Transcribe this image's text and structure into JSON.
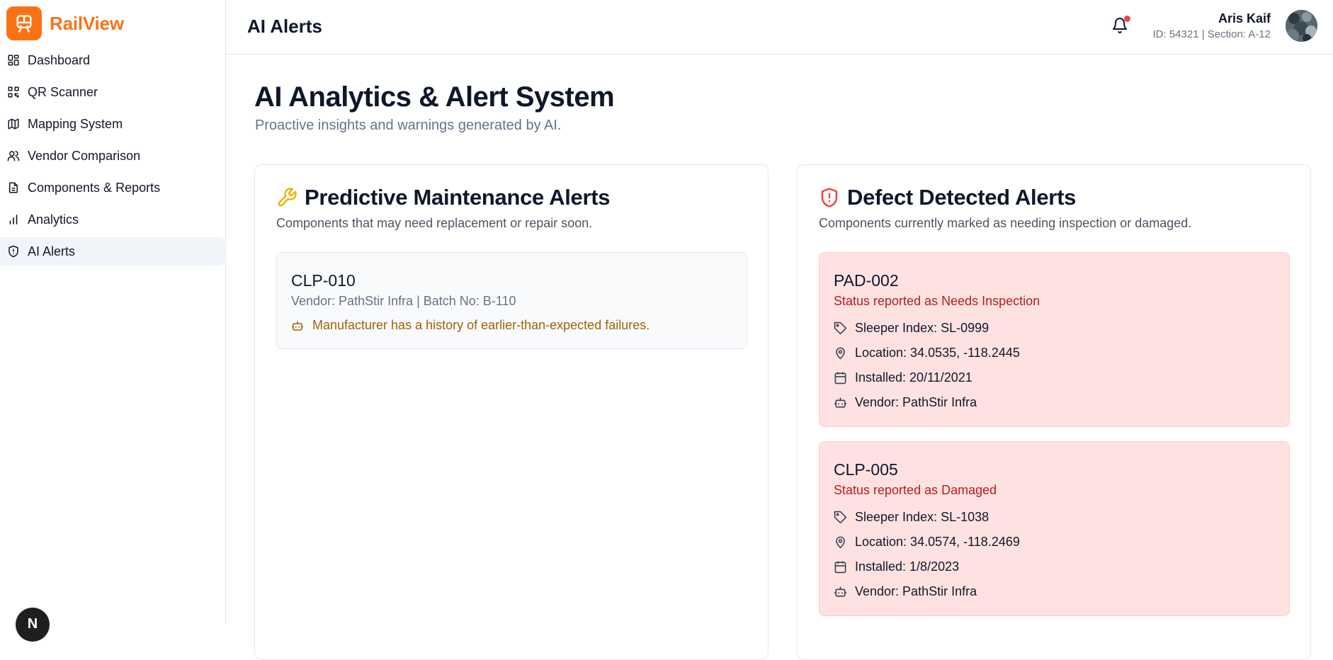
{
  "app": {
    "name": "RailView"
  },
  "sidebar": {
    "items": [
      {
        "label": "Dashboard",
        "icon": "grid-icon"
      },
      {
        "label": "QR Scanner",
        "icon": "qr-icon"
      },
      {
        "label": "Mapping System",
        "icon": "map-icon"
      },
      {
        "label": "Vendor Comparison",
        "icon": "users-icon"
      },
      {
        "label": "Components & Reports",
        "icon": "file-icon"
      },
      {
        "label": "Analytics",
        "icon": "bar-chart-icon"
      },
      {
        "label": "AI Alerts",
        "icon": "shield-alert-icon",
        "active": true
      }
    ],
    "avatar_initial": "N"
  },
  "header": {
    "title": "AI Alerts",
    "user": {
      "name": "Aris Kaif",
      "meta": "ID: 54321 | Section: A-12"
    }
  },
  "main": {
    "title": "AI Analytics & Alert System",
    "subtitle": "Proactive insights and warnings generated by AI.",
    "predictive": {
      "title": "Predictive Maintenance Alerts",
      "description": "Components that may need replacement or repair soon.",
      "cards": [
        {
          "code": "CLP-010",
          "sub": "Vendor: PathStir Infra | Batch No: B-110",
          "warning": "Manufacturer has a history of earlier-than-expected failures."
        }
      ]
    },
    "defects": {
      "title": "Defect Detected Alerts",
      "description": "Components currently marked as needing inspection or damaged.",
      "cards": [
        {
          "code": "PAD-002",
          "status": "Status reported as Needs Inspection",
          "sleeper": "Sleeper Index: SL-0999",
          "location": "Location: 34.0535, -118.2445",
          "installed": "Installed: 20/11/2021",
          "vendor": "Vendor: PathStir Infra"
        },
        {
          "code": "CLP-005",
          "status": "Status reported as Damaged",
          "sleeper": "Sleeper Index: SL-1038",
          "location": "Location: 34.0574, -118.2469",
          "installed": "Installed: 1/8/2023",
          "vendor": "Vendor: PathStir Infra"
        }
      ]
    }
  },
  "colors": {
    "brand": "#f97316",
    "warning_text": "#a16207",
    "danger_text": "#b91c1c",
    "defect_bg": "#fee2e2",
    "notification_dot": "#ef4444"
  }
}
